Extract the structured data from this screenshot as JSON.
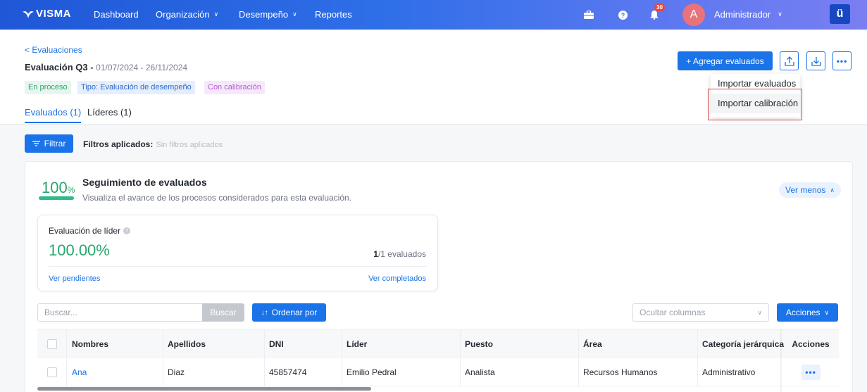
{
  "topbar": {
    "logo": "VISMA",
    "nav": [
      "Dashboard",
      "Organización",
      "Desempeño",
      "Reportes"
    ],
    "notifications_count": "30",
    "avatar_initial": "A",
    "user_name": "Administrador",
    "app_icon": "ü"
  },
  "header": {
    "back_link": "< Evaluaciones",
    "title": "Evaluación Q3 - ",
    "date_range": "01/07/2024 - 26/11/2024",
    "badges": [
      "En proceso",
      "Tipo: Evaluación de desempeño",
      "Con calibración"
    ],
    "tabs": [
      "Evaluados (1)",
      "Líderes (1)"
    ],
    "add_button": "+ Agregar evaluados",
    "menu": [
      "Importar evaluados",
      "Importar calibración"
    ]
  },
  "filters": {
    "button": "Filtrar",
    "label": "Filtros aplicados:",
    "value": "Sin filtros aplicados"
  },
  "tracking": {
    "percent": "100",
    "percent_unit": "%",
    "title": "Seguimiento de evaluados",
    "subtitle": "Visualiza el avance de los procesos considerados para esta evaluación.",
    "toggle": "Ver menos",
    "leader_card": {
      "title": "Evaluación de líder",
      "percent": "100.00%",
      "count_done": "1",
      "count_rest": "/1 evaluados",
      "link_pending": "Ver pendientes",
      "link_completed": "Ver completados"
    }
  },
  "table_toolbar": {
    "search_placeholder": "Buscar...",
    "search_button": "Buscar",
    "sort_button": "Ordenar por",
    "columns_select": "Ocultar columnas",
    "actions_button": "Acciones"
  },
  "table": {
    "columns": [
      "Nombres",
      "Apellidos",
      "DNI",
      "Líder",
      "Puesto",
      "Área",
      "Categoría jerárquica",
      "Acciones"
    ],
    "rows": [
      {
        "nombres": "Ana",
        "apellidos": "Diaz",
        "dni": "45857474",
        "lider": "Emilio Pedral",
        "puesto": "Analista",
        "area": "Recursos Humanos",
        "categoria": "Administrativo"
      }
    ]
  },
  "colors": {
    "accent": "#1a73e8",
    "success": "#2aa56f",
    "highlight_border": "#d74a4a"
  }
}
